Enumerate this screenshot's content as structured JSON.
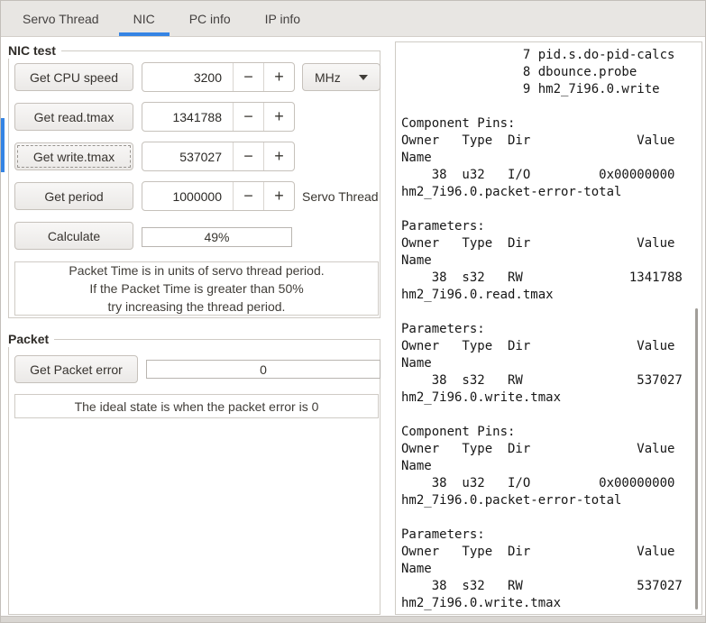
{
  "tabs": {
    "items": [
      {
        "label": "Servo Thread"
      },
      {
        "label": "NIC"
      },
      {
        "label": "PC info"
      },
      {
        "label": "IP info"
      }
    ],
    "active": "NIC"
  },
  "accent_color": "#3584e4",
  "nic_test": {
    "title": "NIC test",
    "controls": {
      "minus": "−",
      "plus": "+"
    },
    "cpu": {
      "button": "Get CPU speed",
      "value": "3200",
      "unit": "MHz"
    },
    "read": {
      "button": "Get read.tmax",
      "value": "1341788"
    },
    "write": {
      "button": "Get write.tmax",
      "value": "537027"
    },
    "period": {
      "button": "Get period",
      "value": "1000000",
      "label": "Servo Thread"
    },
    "calc": {
      "button": "Calculate",
      "progress": "49%"
    },
    "note": [
      "Packet Time is in units of servo thread period.",
      "If the Packet Time is greater than 50%",
      "try increasing the thread period."
    ]
  },
  "packet": {
    "title": "Packet",
    "button": "Get Packet error",
    "value": "0",
    "note": "The ideal state is when the packet error is 0"
  },
  "output": {
    "text": "                7 pid.s.do-pid-calcs\n                8 dbounce.probe\n                9 hm2_7i96.0.write\n\nComponent Pins:\nOwner   Type  Dir              Value\nName\n    38  u32   I/O         0x00000000\nhm2_7i96.0.packet-error-total\n\nParameters:\nOwner   Type  Dir              Value\nName\n    38  s32   RW              1341788\nhm2_7i96.0.read.tmax\n\nParameters:\nOwner   Type  Dir              Value\nName\n    38  s32   RW               537027\nhm2_7i96.0.write.tmax\n\nComponent Pins:\nOwner   Type  Dir              Value\nName\n    38  u32   I/O         0x00000000\nhm2_7i96.0.packet-error-total\n\nParameters:\nOwner   Type  Dir              Value\nName\n    38  s32   RW               537027\nhm2_7i96.0.write.tmax"
  }
}
